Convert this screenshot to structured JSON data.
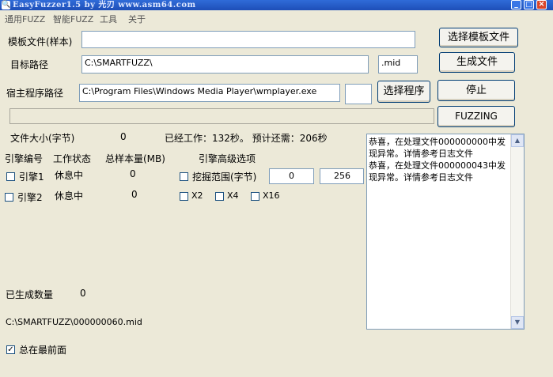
{
  "window": {
    "title": "EasyFuzzer1.5  by 光刃 www.asm64.com",
    "icon": "app-icon",
    "controls": [
      "minimize",
      "maximize",
      "close"
    ]
  },
  "menu": [
    "通用FUZZ",
    "智能FUZZ",
    "工具",
    "关于"
  ],
  "template": {
    "label": "模板文件(样本)",
    "value": "",
    "button": "选择模板文件"
  },
  "target": {
    "label": "目标路径",
    "value": "C:\\SMARTFUZZ\\",
    "ext": ".mid",
    "button": "生成文件"
  },
  "host": {
    "label": "宿主程序路径",
    "value": "C:\\Program Files\\Windows Media Player\\wmplayer.exe",
    "extra": "",
    "select_button": "选择程序",
    "stop_button": "停止"
  },
  "fuzzing_button": "FUZZING",
  "stats": {
    "filesize_label": "文件大小(字节)",
    "filesize_value": "0",
    "worked": "已经工作：132秒。 预计还需：206秒"
  },
  "engines": {
    "headers": [
      "引擎编号",
      "工作状态",
      "总样本量(MB)",
      "引擎高级选项"
    ],
    "rows": [
      {
        "name": "引擎1",
        "status": "休息中",
        "count": "0",
        "checked": false
      },
      {
        "name": "引擎2",
        "status": "休息中",
        "count": "0",
        "checked": false
      }
    ],
    "range": {
      "label": "挖掘范围(字节)",
      "from": "0",
      "to": "256",
      "checked": false
    },
    "multipliers": [
      {
        "label": "X2",
        "checked": false
      },
      {
        "label": "X4",
        "checked": false
      },
      {
        "label": "X16",
        "checked": false
      }
    ]
  },
  "generated": {
    "label": "已生成数量",
    "value": "0"
  },
  "current_file": "C:\\SMARTFUZZ\\000000060.mid",
  "always_on_top": {
    "label": "总在最前面",
    "checked": true
  },
  "log": [
    "恭喜，在处理文件000000000中发",
    "现异常。详情参考日志文件",
    "恭喜，在处理文件000000043中发",
    "现异常。详情参考日志文件"
  ]
}
